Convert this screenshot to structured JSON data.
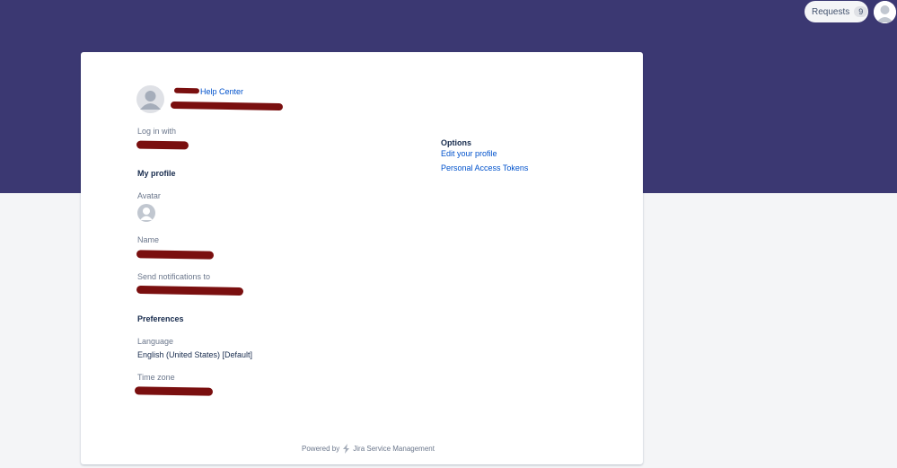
{
  "header": {
    "requests_label": "Requests",
    "requests_count": "9"
  },
  "profile": {
    "help_center_label": "Help Center",
    "login_label": "Log in with",
    "my_profile_heading": "My profile",
    "avatar_label": "Avatar",
    "name_label": "Name",
    "notifications_label": "Send notifications to",
    "preferences_heading": "Preferences",
    "language_label": "Language",
    "language_value": "English (United States) [Default]",
    "timezone_label": "Time zone"
  },
  "options": {
    "heading": "Options",
    "edit_profile": "Edit your profile",
    "access_tokens": "Personal Access Tokens"
  },
  "footer": {
    "powered_by": "Powered by",
    "product": "Jira Service Management"
  },
  "colors": {
    "banner": "#3b3872",
    "link": "#0052cc",
    "redaction": "#7a0f0f"
  }
}
